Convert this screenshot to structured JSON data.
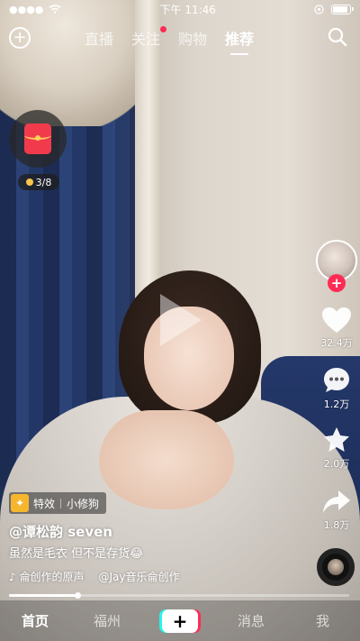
{
  "status_bar": {
    "time": "下午 11:46"
  },
  "top_nav": {
    "tabs": [
      {
        "label": "直播",
        "active": false
      },
      {
        "label": "关注",
        "active": false,
        "badge": true
      },
      {
        "label": "购物",
        "active": false
      },
      {
        "label": "推荐",
        "active": true
      }
    ],
    "add_icon": "plus-circle-icon",
    "search_icon": "search-icon"
  },
  "red_packet": {
    "count": "3/8",
    "icon": "red-envelope-icon"
  },
  "actions": {
    "like_count": "32.4万",
    "comment_count": "1.2万",
    "favorite_count": "2.0万",
    "share_count": "1.8万"
  },
  "video_info": {
    "effect_label": "特效",
    "effect_name": "小修狗",
    "author": "@谭松韵 seven",
    "caption": "虽然是毛衣 但不是存货😂",
    "music_original": "♪ 侖创作的原声",
    "music_credit": "@Jay音乐侖创作",
    "progress": 0.2
  },
  "bottom_nav": {
    "items": [
      {
        "label": "首页",
        "active": true
      },
      {
        "label": "福州",
        "active": false
      },
      {
        "label": "消息",
        "active": false
      },
      {
        "label": "我",
        "active": false
      }
    ],
    "create_label": "+"
  },
  "colors": {
    "accent": "#fe2c55",
    "coin": "#f7c64a",
    "teal": "#25f4ee"
  }
}
